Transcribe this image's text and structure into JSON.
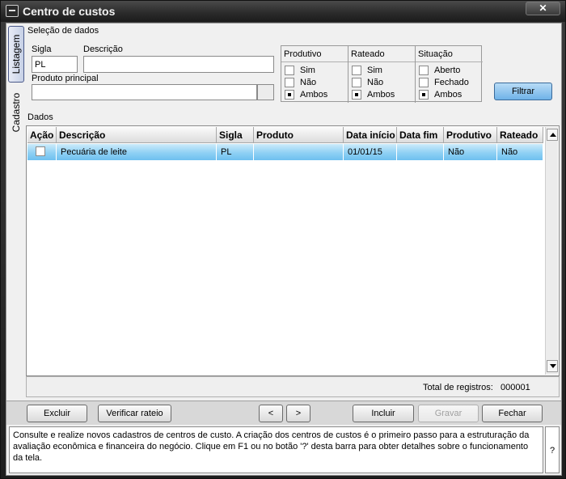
{
  "window": {
    "title": "Centro de custos",
    "close_label": "✕"
  },
  "tabs": [
    {
      "label": "Listagem"
    },
    {
      "label": "Cadastro"
    }
  ],
  "selection": {
    "group_label": "Seleção de dados",
    "sigla_label": "Sigla",
    "sigla_value": "PL",
    "descricao_label": "Descrição",
    "descricao_value": "",
    "produto_label": "Produto principal",
    "produto_value": ""
  },
  "filters": {
    "produtivo": {
      "title": "Produtivo",
      "options": [
        "Sim",
        "Não",
        "Ambos"
      ],
      "selected": "Ambos"
    },
    "rateado": {
      "title": "Rateado",
      "options": [
        "Sim",
        "Não",
        "Ambos"
      ],
      "selected": "Ambos"
    },
    "situacao": {
      "title": "Situação",
      "options": [
        "Aberto",
        "Fechado",
        "Ambos"
      ],
      "selected": "Ambos"
    },
    "filter_button": "Filtrar"
  },
  "data_section": {
    "label": "Dados"
  },
  "table": {
    "columns": [
      "Ação",
      "Descrição",
      "Sigla",
      "Produto",
      "Data início",
      "Data fim",
      "Produtivo",
      "Rateado"
    ],
    "rows": [
      {
        "acao": "",
        "descricao": "Pecuária de leite",
        "sigla": "PL",
        "produto": "",
        "data_inicio": "01/01/15",
        "data_fim": "",
        "produtivo": "Não",
        "rateado": "Não"
      }
    ]
  },
  "total": {
    "label": "Total de registros:",
    "value": "000001"
  },
  "buttons": {
    "excluir": "Excluir",
    "verificar": "Verificar rateio",
    "prev": "<",
    "next": ">",
    "incluir": "Incluir",
    "gravar": "Gravar",
    "fechar": "Fechar"
  },
  "help": {
    "text": "Consulte e realize novos cadastros de centros de custo. A criação dos centros de custos é o primeiro passo para a estruturação da avaliação econômica e financeira do negócio. Clique em F1 ou no botão '?' desta barra para obter detalhes sobre o funcionamento da tela.",
    "question": "?"
  }
}
